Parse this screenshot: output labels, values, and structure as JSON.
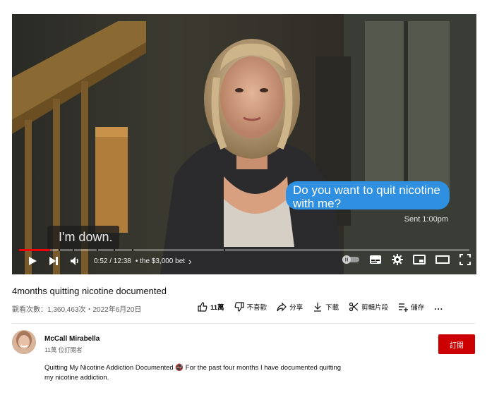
{
  "player": {
    "caption": "I'm down.",
    "message_bubble": "Do you want to quit nicotine with me?",
    "message_status": "Sent 1:00pm",
    "time": "0:52 / 12:38",
    "chapter": "• the $3,000 bet",
    "chapter_chevron": "›",
    "progress_fraction": 0.069
  },
  "video": {
    "title": "4months quitting nicotine documented",
    "views_date": "觀看次數：1,360,463次・2022年6月20日"
  },
  "actions": {
    "like_count": "11萬",
    "dislike": "不喜歡",
    "share": "分享",
    "download": "下載",
    "clip": "剪輯片段",
    "save": "儲存",
    "more": "..."
  },
  "channel": {
    "name": "McCall Mirabella",
    "subscribers": "11萬 位訂閱者",
    "subscribe": "訂閱"
  },
  "description": "Quitting My Nicotine Addiction Documented 🚭 For the past four months I have documented quitting my nicotine addiction.",
  "icons": [
    "play-icon",
    "next-icon",
    "volume-icon",
    "autoplay-toggle",
    "subtitles-icon",
    "settings-icon",
    "miniplayer-icon",
    "theater-icon",
    "fullscreen-icon",
    "like-icon",
    "dislike-icon",
    "share-icon",
    "download-icon",
    "clip-icon",
    "save-icon"
  ]
}
